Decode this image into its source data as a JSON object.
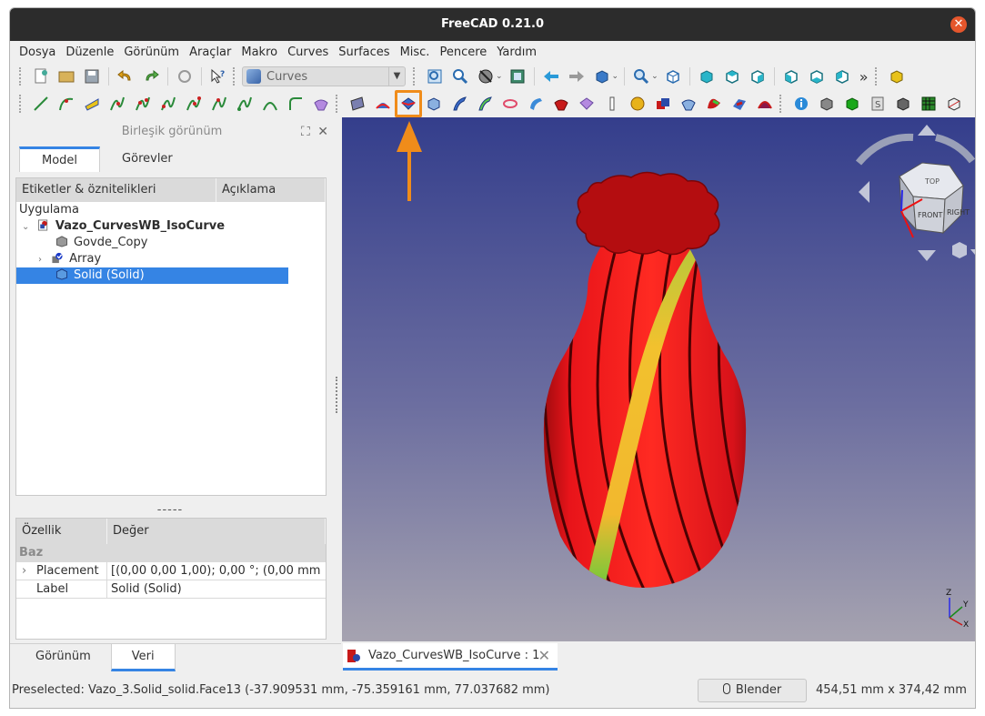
{
  "window": {
    "title": "FreeCAD 0.21.0"
  },
  "menu": [
    "Dosya",
    "Düzenle",
    "Görünüm",
    "Araçlar",
    "Makro",
    "Curves",
    "Surfaces",
    "Misc.",
    "Pencere",
    "Yardım"
  ],
  "toolbar": {
    "workbench": "Curves",
    "more": "»"
  },
  "combo_view": {
    "title": "Birleşik görünüm",
    "tabs": [
      "Model",
      "Görevler"
    ],
    "tree_headers": [
      "Etiketler & öznitelikleri",
      "Açıklama"
    ],
    "tree": {
      "root": "Uygulama",
      "document": "Vazo_CurvesWB_IsoCurve",
      "items": [
        "Govde_Copy",
        "Array",
        "Solid (Solid)"
      ]
    },
    "splitter": "-----",
    "props_headers": [
      "Özellik",
      "Değer"
    ],
    "props_group": "Baz",
    "props": [
      {
        "key": "Placement",
        "value": "[(0,00 0,00 1,00); 0,00 °; (0,00 mm  ..."
      },
      {
        "key": "Label",
        "value": "Solid (Solid)"
      }
    ],
    "bottom_tabs": [
      "Görünüm",
      "Veri"
    ]
  },
  "navcube": {
    "faces": [
      "TOP",
      "FRONT",
      "RIGHT"
    ]
  },
  "axis": {
    "z": "Z",
    "y": "Y",
    "x": "X"
  },
  "doc_tab": "Vazo_CurvesWB_IsoCurve : 1",
  "status": {
    "preselected": "Preselected: Vazo_3.Solid_solid.Face13 (-37.909531 mm, -75.359161 mm, 77.037682 mm)",
    "nav_style": "Blender",
    "dimensions": "454,51 mm x 374,42 mm"
  },
  "colors": {
    "accent": "#3584e4",
    "highlight": "#f08c1a",
    "vase": "#e8141a",
    "vase_top": "#b40d10",
    "face": "#f2c12e"
  }
}
